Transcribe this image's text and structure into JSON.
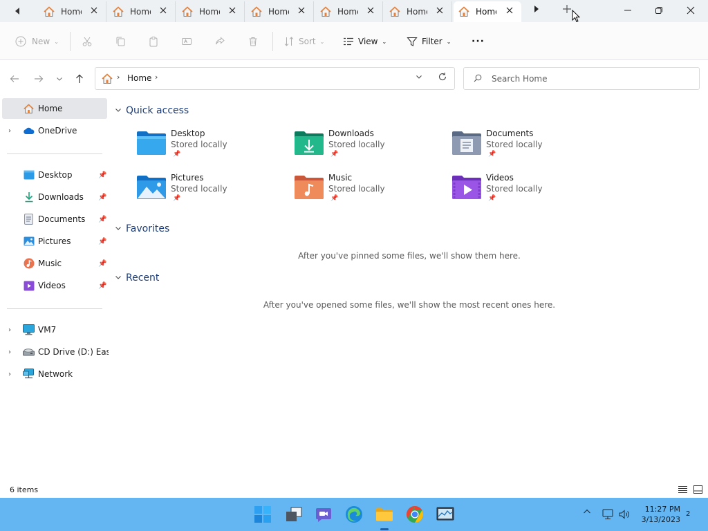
{
  "tabs": [
    {
      "label": "Home",
      "active": false
    },
    {
      "label": "Home",
      "active": false
    },
    {
      "label": "Home",
      "active": false
    },
    {
      "label": "Home",
      "active": false
    },
    {
      "label": "Home",
      "active": false
    },
    {
      "label": "Home",
      "active": false
    },
    {
      "label": "Home",
      "active": true
    }
  ],
  "toolbar": {
    "new_label": "New",
    "sort_label": "Sort",
    "view_label": "View",
    "filter_label": "Filter",
    "more_label": "···"
  },
  "address": {
    "crumb": "Home",
    "search_placeholder": "Search Home"
  },
  "sidebar": {
    "top": [
      {
        "label": "Home",
        "icon": "home-icon",
        "selected": true
      },
      {
        "label": "OneDrive",
        "icon": "onedrive-icon",
        "expandable": true
      }
    ],
    "pinned": [
      {
        "label": "Desktop",
        "icon": "desktop-icon"
      },
      {
        "label": "Downloads",
        "icon": "downloads-icon"
      },
      {
        "label": "Documents",
        "icon": "documents-icon"
      },
      {
        "label": "Pictures",
        "icon": "pictures-icon"
      },
      {
        "label": "Music",
        "icon": "music-icon"
      },
      {
        "label": "Videos",
        "icon": "videos-icon"
      }
    ],
    "drives": [
      {
        "label": "VM7",
        "icon": "computer-icon"
      },
      {
        "label": "CD Drive (D:) EasyK",
        "icon": "cd-drive-icon"
      },
      {
        "label": "Network",
        "icon": "network-icon"
      }
    ]
  },
  "main": {
    "quick_access_title": "Quick access",
    "favorites_title": "Favorites",
    "recent_title": "Recent",
    "favorites_empty": "After you've pinned some files, we'll show them here.",
    "recent_empty": "After you've opened some files, we'll show the most recent ones here.",
    "quick_access": [
      {
        "name": "Desktop",
        "sub": "Stored locally",
        "icon": "desktop-folder-icon"
      },
      {
        "name": "Downloads",
        "sub": "Stored locally",
        "icon": "downloads-folder-icon"
      },
      {
        "name": "Documents",
        "sub": "Stored locally",
        "icon": "documents-folder-icon"
      },
      {
        "name": "Pictures",
        "sub": "Stored locally",
        "icon": "pictures-folder-icon"
      },
      {
        "name": "Music",
        "sub": "Stored locally",
        "icon": "music-folder-icon"
      },
      {
        "name": "Videos",
        "sub": "Stored locally",
        "icon": "videos-folder-icon"
      }
    ]
  },
  "status": {
    "item_count": "6 items"
  },
  "taskbar": {
    "time": "11:27 PM",
    "date": "3/13/2023",
    "notification_count": "2"
  },
  "colors": {
    "taskbar": "#63b6f2",
    "accent_header": "#1d3e7a",
    "home_orange": "#e8823a"
  }
}
